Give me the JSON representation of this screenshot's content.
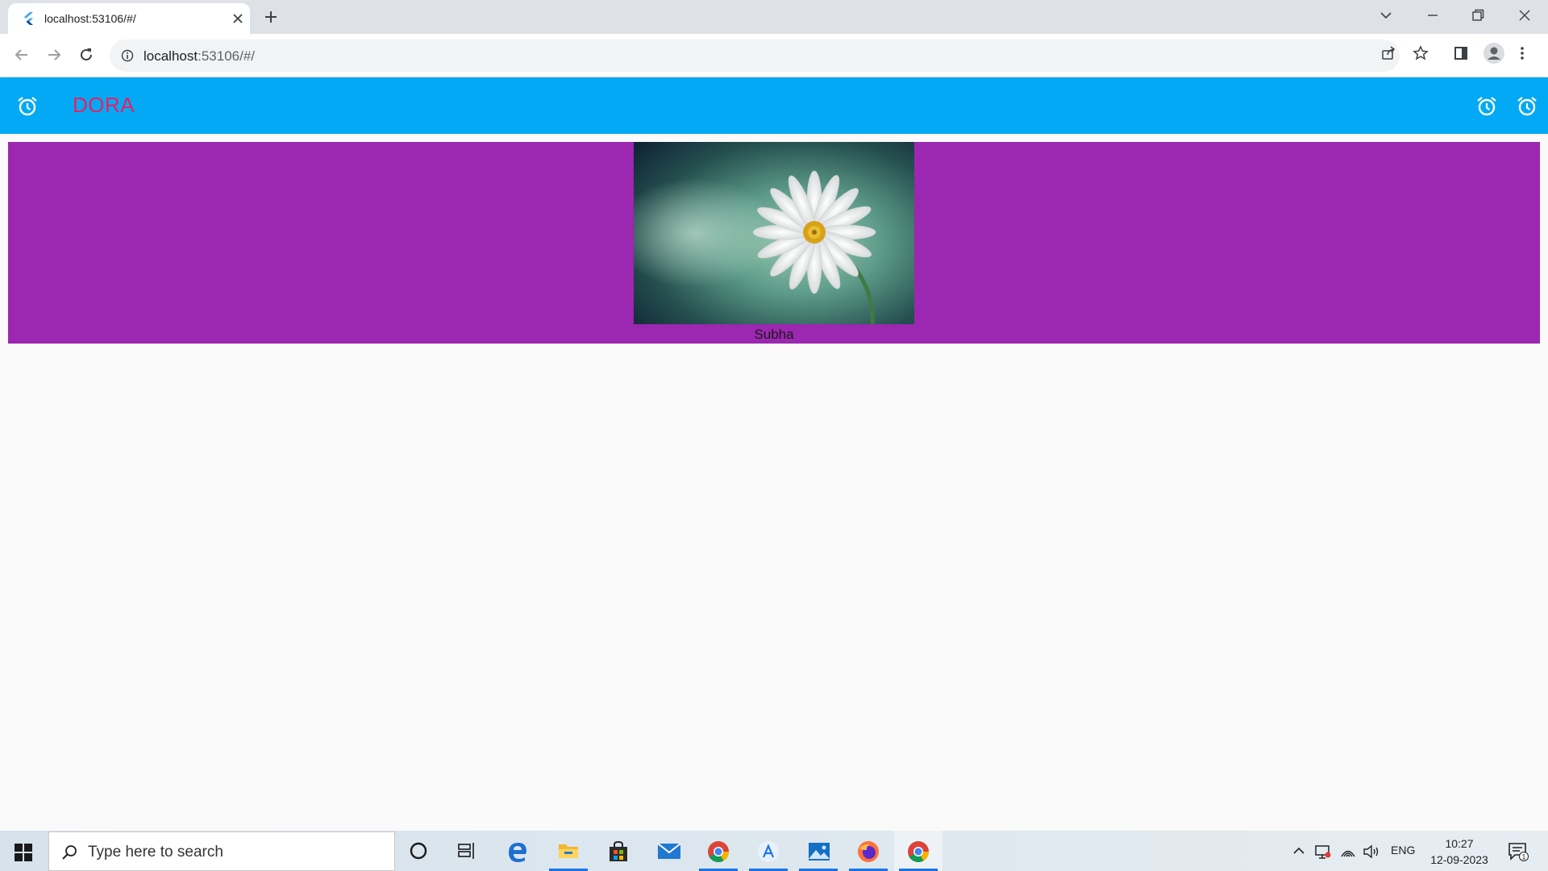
{
  "browser": {
    "tab_title": "localhost:53106/#/",
    "url_host": "localhost",
    "url_rest": ":53106/#/"
  },
  "app": {
    "title": "DORA",
    "colors": {
      "appbar": "#03a9f4",
      "title": "#e91e63",
      "card": "#9c27b0"
    }
  },
  "card": {
    "caption": "Subha",
    "image": "daisy-flower-photo"
  },
  "taskbar": {
    "search_placeholder": "Type here to search",
    "language": "ENG",
    "time": "10:27",
    "date": "12-09-2023",
    "notification_count": "1",
    "pinned_apps": [
      "cortana",
      "task-view",
      "edge",
      "file-explorer",
      "store",
      "mail",
      "chrome",
      "app",
      "photos",
      "firefox",
      "chrome"
    ]
  }
}
